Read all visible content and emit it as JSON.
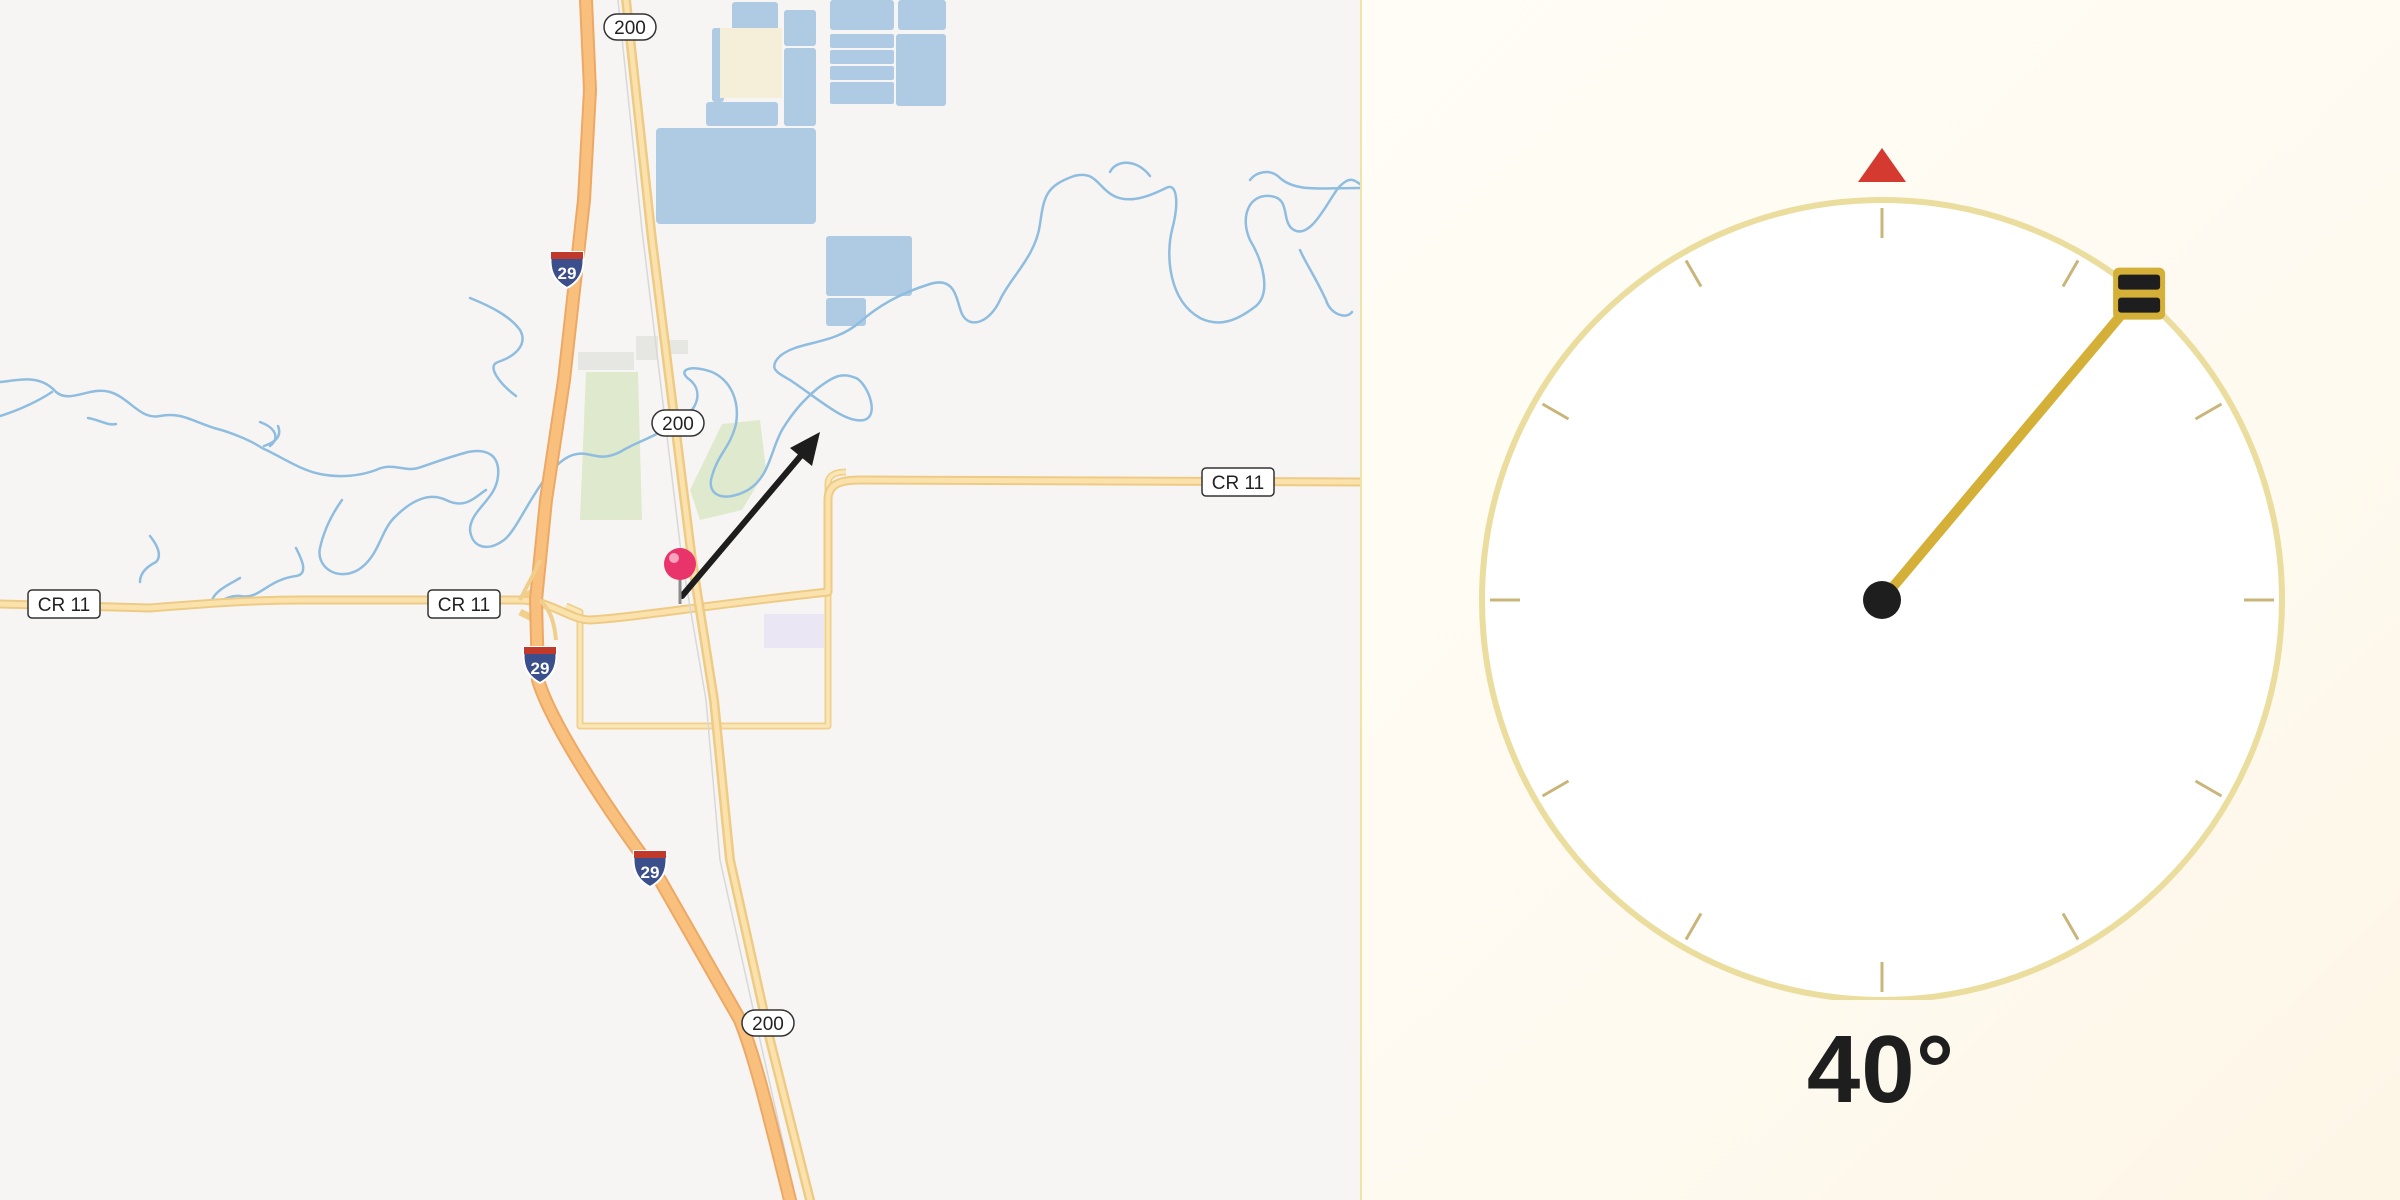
{
  "map": {
    "road_labels": {
      "cr11_left": "CR 11",
      "cr11_mid": "CR 11",
      "cr11_right": "CR 11",
      "hwy200_top": "200",
      "hwy200_mid": "200",
      "hwy200_bottom": "200",
      "i29_top": "29",
      "i29_mid": "29",
      "i29_bottom": "29"
    },
    "marker_icon": "map-pin-icon",
    "direction_icon": "direction-arrow-icon",
    "colors": {
      "water": "#aecbe3",
      "river": "#8fbde0",
      "interstate": "#f6bf7e",
      "road": "#f8d79a",
      "park": "#dfe9cd",
      "pin": "#e8336b"
    }
  },
  "compass": {
    "heading_deg": 40,
    "heading_label": "40°",
    "north_marker_icon": "north-triangle-icon",
    "needle_icon": "compass-needle-icon",
    "colors": {
      "needle": "#d4b038",
      "north": "#d43a30",
      "ring": "#eadd9e"
    }
  }
}
